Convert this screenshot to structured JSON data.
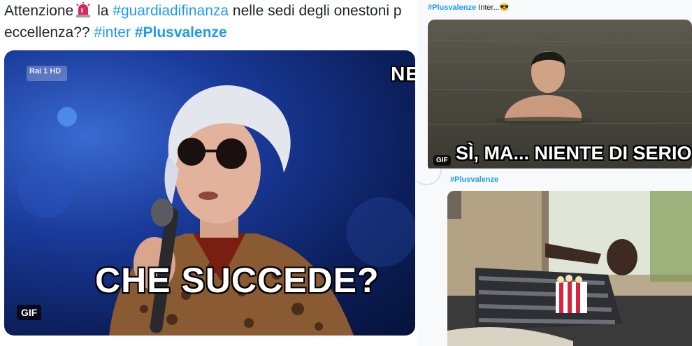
{
  "left_tweet": {
    "text_parts": {
      "w1": "Attenzione",
      "w2": " la ",
      "h1": "#guardiadifinanza",
      "w3": " nelle sedi degli onestoni p",
      "w4": "eccellenza?? ",
      "h2": "#inter",
      "h3": "#Plusvalenze"
    },
    "media": {
      "channel_logo": "Rai 1 HD",
      "corner_text": "NE",
      "caption": "CHE SUCCEDE?",
      "badge": "GIF"
    }
  },
  "right_top_tweet": {
    "hashtag": "#Plusvalenze",
    "text": " Inter...",
    "emoji": "😎",
    "media": {
      "caption": "SÌ, MA... NIENTE DI SERIO",
      "badge": "GIF"
    }
  },
  "right_bottom_tweet": {
    "hashtag": "#Plusvalenze"
  },
  "colors": {
    "hashtag": "#1d9bf0",
    "text": "#1f2328",
    "siren_emoji": "siren-icon"
  }
}
